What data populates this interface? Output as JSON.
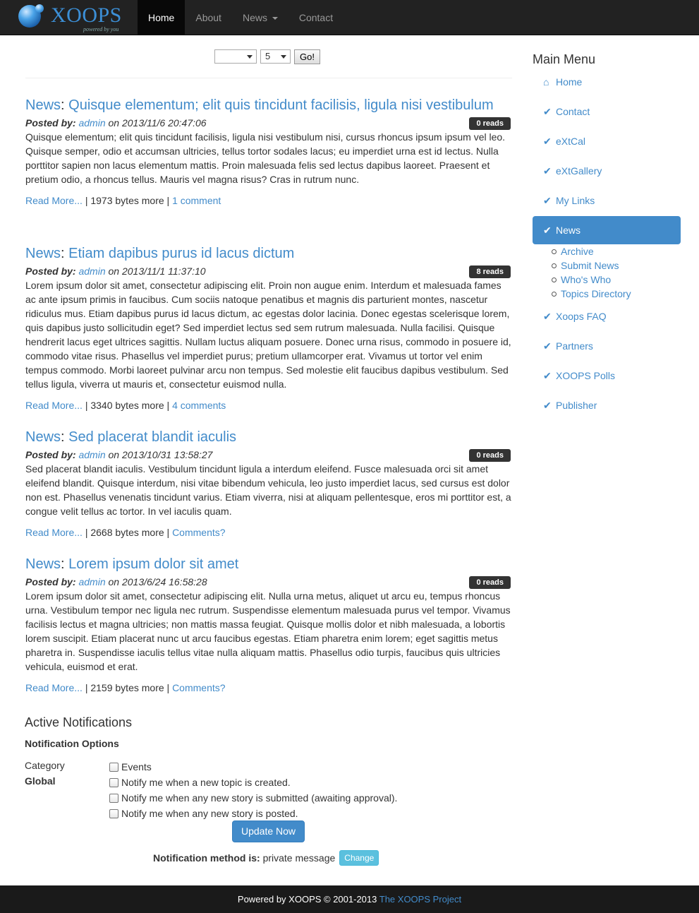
{
  "brand": {
    "name": "XOOPS",
    "tagline": "powered by you"
  },
  "nav": {
    "home": "Home",
    "about": "About",
    "news": "News",
    "contact": "Contact"
  },
  "toolbar": {
    "select1": "",
    "select2": "5",
    "go": "Go!"
  },
  "articles": [
    {
      "topic": "News",
      "title": "Quisque elementum; elit quis tincidunt facilisis, ligula nisi vestibulum",
      "posted_by_label": "Posted by:",
      "author": "admin",
      "on_date": "on 2013/11/6 20:47:06",
      "reads": "0 reads",
      "body": "Quisque elementum; elit quis tincidunt facilisis, ligula nisi vestibulum nisi, cursus rhoncus ipsum ipsum vel leo. Quisque semper, odio et accumsan ultricies, tellus tortor sodales lacus; eu imperdiet urna est id lectus. Nulla porttitor sapien non lacus elementum mattis. Proin malesuada felis sed lectus dapibus laoreet. Praesent et pretium odio, a rhoncus tellus. Mauris vel magna risus? Cras in rutrum nunc.",
      "read_more": "Read More...",
      "bytes": " | 1973 bytes more | ",
      "comments": "1 comment"
    },
    {
      "topic": "News",
      "title": "Etiam dapibus purus id lacus dictum",
      "posted_by_label": "Posted by:",
      "author": "admin",
      "on_date": "on 2013/11/1 11:37:10",
      "reads": "8 reads",
      "body": "Lorem ipsum dolor sit amet, consectetur adipiscing elit. Proin non augue enim. Interdum et malesuada fames ac ante ipsum primis in faucibus. Cum sociis natoque penatibus et magnis dis parturient montes, nascetur ridiculus mus. Etiam dapibus purus id lacus dictum, ac egestas dolor lacinia. Donec egestas scelerisque lorem, quis dapibus justo sollicitudin eget? Sed imperdiet lectus sed sem rutrum malesuada. Nulla facilisi. Quisque hendrerit lacus eget ultrices sagittis. Nullam luctus aliquam posuere. Donec urna risus, commodo in posuere id, commodo vitae risus. Phasellus vel imperdiet purus; pretium ullamcorper erat. Vivamus ut tortor vel enim tempus commodo. Morbi laoreet pulvinar arcu non tempus. Sed molestie elit faucibus dapibus vestibulum. Sed tellus ligula, viverra ut mauris et, consectetur euismod nulla.",
      "read_more": "Read More...",
      "bytes": " | 3340 bytes more | ",
      "comments": "4 comments"
    },
    {
      "topic": "News",
      "title": "Sed placerat blandit iaculis",
      "posted_by_label": "Posted by:",
      "author": "admin",
      "on_date": "on 2013/10/31 13:58:27",
      "reads": "0 reads",
      "body": "Sed placerat blandit iaculis. Vestibulum tincidunt ligula a interdum eleifend. Fusce malesuada orci sit amet eleifend blandit. Quisque interdum, nisi vitae bibendum vehicula, leo justo imperdiet lacus, sed cursus est dolor non est. Phasellus venenatis tincidunt varius. Etiam viverra, nisi at aliquam pellentesque, eros mi porttitor est, a congue velit tellus ac tortor. In vel iaculis quam.",
      "read_more": "Read More...",
      "bytes": " | 2668 bytes more | ",
      "comments": "Comments?"
    },
    {
      "topic": "News",
      "title": "Lorem ipsum dolor sit amet",
      "posted_by_label": "Posted by:",
      "author": "admin",
      "on_date": "on 2013/6/24 16:58:28",
      "reads": "0 reads",
      "body": "Lorem ipsum dolor sit amet, consectetur adipiscing elit. Nulla urna metus, aliquet ut arcu eu, tempus rhoncus urna. Vestibulum tempor nec ligula nec rutrum. Suspendisse elementum malesuada purus vel tempor. Vivamus facilisis lectus et magna ultricies; non mattis massa feugiat. Quisque mollis dolor et nibh malesuada, a lobortis lorem suscipit. Etiam placerat nunc ut arcu faucibus egestas. Etiam pharetra enim lorem; eget sagittis metus pharetra in. Suspendisse iaculis tellus vitae nulla aliquam mattis. Phasellus odio turpis, faucibus quis ultricies vehicula, euismod et erat.",
      "read_more": "Read More...",
      "bytes": " | 2159 bytes more | ",
      "comments": "Comments?"
    }
  ],
  "notifications": {
    "heading": "Active Notifications",
    "options_heading": "Notification Options",
    "category_label": "Category",
    "global_label": "Global",
    "options": [
      "Events",
      "Notify me when a new topic is created.",
      "Notify me when any new story is submitted (awaiting approval).",
      "Notify me when any new story is posted."
    ],
    "update_button": "Update Now",
    "method_label": "Notification method is:",
    "method_value": "private message",
    "change_button": "Change"
  },
  "sidebar": {
    "title": "Main Menu",
    "items": [
      {
        "label": "Home",
        "icon": "home-icon"
      },
      {
        "label": "Contact",
        "icon": "check-icon"
      },
      {
        "label": "eXtCal",
        "icon": "check-icon"
      },
      {
        "label": "eXtGallery",
        "icon": "check-icon"
      },
      {
        "label": "My Links",
        "icon": "check-icon"
      },
      {
        "label": "News",
        "icon": "check-icon",
        "active": true
      },
      {
        "label": "Xoops FAQ",
        "icon": "check-icon"
      },
      {
        "label": "Partners",
        "icon": "check-icon"
      },
      {
        "label": "XOOPS Polls",
        "icon": "check-icon"
      },
      {
        "label": "Publisher",
        "icon": "check-icon"
      }
    ],
    "news_sub": [
      "Archive",
      "Submit News",
      "Who's Who",
      "Topics Directory"
    ]
  },
  "footer": {
    "text": "Powered by XOOPS © 2001-2013 ",
    "link": "The XOOPS Project"
  },
  "colors": {
    "link": "#428bca",
    "navbar": "#222222",
    "active_menu": "#428bca",
    "badge": "#333333",
    "info_button": "#5bc0de"
  }
}
